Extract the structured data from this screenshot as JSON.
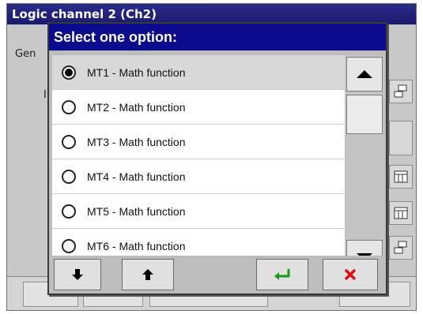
{
  "background_window": {
    "title": "Logic channel 2 (Ch2)",
    "tab_partial": "Gen",
    "label_partial": "I"
  },
  "dialog": {
    "title": "Select one option:",
    "options": [
      {
        "label": "MT1 - Math function",
        "selected": true
      },
      {
        "label": "MT2 - Math function",
        "selected": false
      },
      {
        "label": "MT3 - Math function",
        "selected": false
      },
      {
        "label": "MT4 - Math function",
        "selected": false
      },
      {
        "label": "MT5 - Math function",
        "selected": false
      },
      {
        "label": "MT6 - Math function",
        "selected": false
      }
    ],
    "buttons": {
      "move_down": "arrow-down-icon",
      "move_up": "arrow-up-icon",
      "confirm": "enter-icon",
      "cancel": "close-icon"
    }
  },
  "colors": {
    "title_bar": "#0a0a8c",
    "confirm_green": "#1a9a1a",
    "cancel_red": "#e01010"
  }
}
